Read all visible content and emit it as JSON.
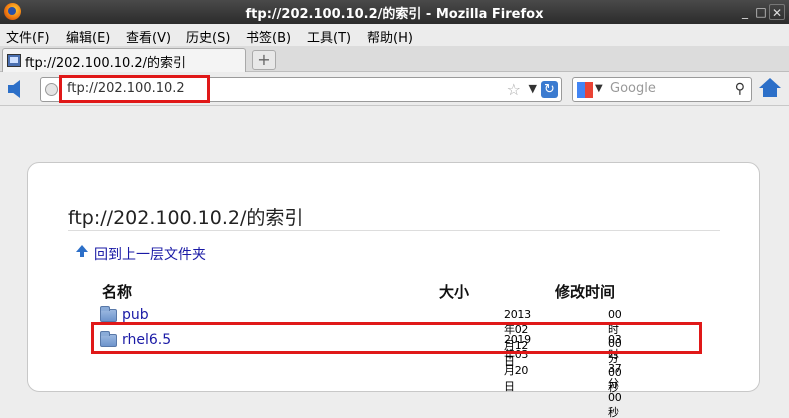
{
  "window": {
    "title": "ftp://202.100.10.2/的索引 - Mozilla Firefox"
  },
  "menu": [
    "文件(F)",
    "编辑(E)",
    "查看(V)",
    "历史(S)",
    "书签(B)",
    "工具(T)",
    "帮助(H)"
  ],
  "tab": {
    "label": "ftp://202.100.10.2/的索引"
  },
  "urlbar": {
    "value": "ftp://202.100.10.2"
  },
  "search": {
    "placeholder": "Google"
  },
  "page": {
    "heading": "ftp://202.100.10.2/的索引",
    "up_link": "回到上一层文件夹",
    "columns": {
      "name": "名称",
      "size": "大小",
      "modified": "修改时间"
    },
    "rows": [
      {
        "name": "pub",
        "size": "",
        "date": "2013年02月12日",
        "time": "00时00分00秒"
      },
      {
        "name": "rhel6.5",
        "size": "",
        "date": "2019年03月20日",
        "time": "03时37分00秒"
      }
    ]
  },
  "colors": {
    "highlight": "#e01818",
    "link": "#1a1aa6",
    "accent": "#2c6fc8"
  }
}
